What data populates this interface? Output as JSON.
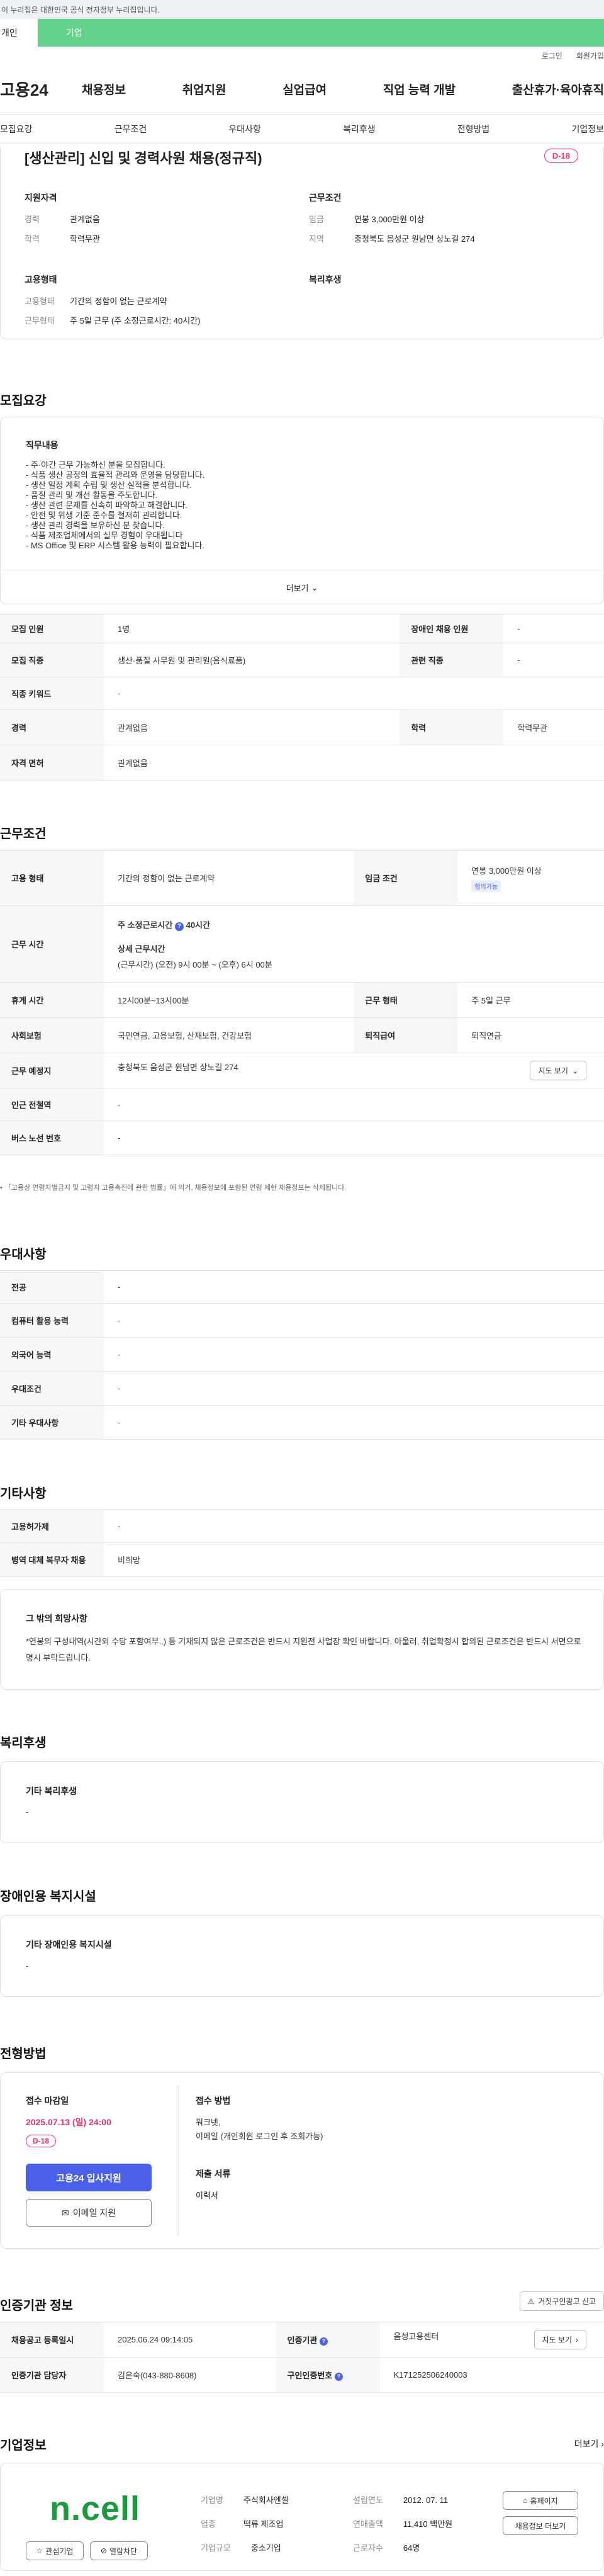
{
  "banner": {
    "text": "이 누리집은 대한민국 공식 전자정부 누리집입니다."
  },
  "topTabs": {
    "a": "개인",
    "b": "기업"
  },
  "util": {
    "login": "로그인",
    "join": "회원가입"
  },
  "gnb": {
    "logo": "고용24",
    "items": [
      "채용정보",
      "취업지원",
      "실업급여",
      "직업 능력 개발",
      "출산휴가·육아휴직"
    ]
  },
  "subnav": [
    "모집요강",
    "근무조건",
    "우대사항",
    "복리후생",
    "전형방법",
    "기업정보"
  ],
  "headerCard": {
    "title": "[생산관리] 신입 및 경력사원 채용(정규직)",
    "dday": "D-18",
    "qualTitle": "지원자격",
    "qual": [
      {
        "k": "경력",
        "v": "관계없음"
      },
      {
        "k": "학력",
        "v": "학력무관"
      }
    ],
    "condTitle": "근무조건",
    "cond": [
      {
        "k": "임금",
        "v": "연봉 3,000만원 이상"
      },
      {
        "k": "지역",
        "v": "충청북도 음성군 원남면 상노길 274"
      }
    ],
    "empTitle": "고용형태",
    "emp": [
      {
        "k": "고용형태",
        "v": "기간의 정함이 없는 근로계약"
      },
      {
        "k": "근무형태",
        "v": "주 5일 근무 (주 소정근로시간: 40시간)"
      }
    ],
    "welfareTitle": "복리후생"
  },
  "recruit": {
    "title": "모집요강",
    "dutyTitle": "직무내용",
    "duties": [
      "- 주·야간 근무 가능하신 분을 모집합니다.",
      "- 식품 생산 공정의 효율적 관리와 운영을 담당합니다.",
      "- 생산 일정 계획 수립 및 생산 실적을 분석합니다.",
      "- 품질 관리 및 개선 활동을 주도합니다.",
      "- 생산 관련 문제를 신속히 파악하고 해결합니다.",
      "- 안전 및 위생 기준 준수를 철저히 관리합니다.",
      "- 생산 관리 경력을 보유하신 분 찾습니다.",
      "- 식품 제조업체에서의 실무 경험이 우대됩니다",
      "- MS Office 및 ERP 시스템 활용 능력이 필요합니다."
    ],
    "more": "더보기"
  },
  "recruitTable": {
    "rows": [
      {
        "k1": "모집 인원",
        "v1": "1명",
        "k2": "장애인 채용 인원",
        "v2": "-"
      },
      {
        "k1": "모집 직종",
        "v1": "생산·품질 사무원 및 관리원(음식료품)",
        "k2": "관련 직종",
        "v2": "-"
      },
      {
        "k1": "직종 키워드",
        "v1": "-"
      },
      {
        "k1": "경력",
        "v1": "관계없음",
        "k2": "학력",
        "v2": "학력무관"
      },
      {
        "k1": "자격 면허",
        "v1": "관계없음"
      }
    ]
  },
  "work": {
    "title": "근무조건",
    "empType": {
      "k": "고용 형태",
      "v": "기간의 정함이 없는 근로계약"
    },
    "wage": {
      "k": "임금 조건",
      "v": "연봉 3,000만원 이상",
      "badge": "협의가능"
    },
    "hours": {
      "k": "근무 시간",
      "line1": "주 소정근로시간",
      "hrs": "40시간",
      "line2": "상세 근무시간",
      "line3": "(근무시간) (오전) 9시 00분 ~ (오후) 6시 00분"
    },
    "break": {
      "k": "휴게 시간",
      "v": "12시00분~13시00분",
      "k2": "근무 형태",
      "v2": "주 5일 근무"
    },
    "insurance": {
      "k": "사회보험",
      "v": "국민연금, 고용보험, 산재보험, 건강보험",
      "k2": "퇴직급여",
      "v2": "퇴직연금"
    },
    "place": {
      "k": "근무 예정지",
      "v": "충청북도 음성군 원남면 상노길 274",
      "btn": "지도 보기"
    },
    "subway": {
      "k": "인근 전철역",
      "v": "-"
    },
    "bus": {
      "k": "버스 노선 번호",
      "v": "-"
    },
    "note": "「고용상 연령차별금지 및 고령자 고용촉진에 관한 법률」에 의거, 채용정보에 포함된 연령 제한 채용정보는 삭제됩니다."
  },
  "pref": {
    "title": "우대사항",
    "rows": [
      {
        "k": "전공",
        "v": "-"
      },
      {
        "k": "컴퓨터 활용 능력",
        "v": "-"
      },
      {
        "k": "외국어 능력",
        "v": "-"
      },
      {
        "k": "우대조건",
        "v": "-"
      },
      {
        "k": "기타 우대사항",
        "v": "-"
      }
    ]
  },
  "etc": {
    "title": "기타사항",
    "rows": [
      {
        "k": "고용허가제",
        "v": "-"
      },
      {
        "k": "병역 대체 복무자 채용",
        "v": "비희망"
      }
    ],
    "boxTitle": "그 밖의 희망사항",
    "boxText": "*연봉의 구성내역(시간외 수당 포함여부..) 등 기재되지 않은 근로조건은 반드시 지원전 사업장 확인 바랍니다. 아울러, 취업확정시 합의된 근로조건은 반드시 서면으로 명시 부탁드립니다."
  },
  "welfare": {
    "title": "복리후생",
    "sub": "기타 복리후생",
    "v": "-"
  },
  "disability": {
    "title": "장애인용 복지시설",
    "sub": "기타 장애인용 복지시설",
    "v": "-"
  },
  "process": {
    "title": "전형방법",
    "deadlineK": "접수 마감일",
    "deadline": "2025.07.13 (일) 24:00",
    "dday": "D-18",
    "applyBtn": "고용24 입사지원",
    "emailBtn": "이메일 지원",
    "methodK": "접수 방법",
    "method1": "워크넷,",
    "method2": "이메일 (개인회원 로그인 후 조회가능)",
    "docsK": "제출 서류",
    "docs": "이력서"
  },
  "agency": {
    "title": "인증기관 정보",
    "reportBtn": "거짓구인광고 신고",
    "rows": [
      {
        "k1": "채용공고 등록일시",
        "v1": "2025.06.24 09:14:05",
        "k2": "인증기관",
        "v2": "음성고용센터",
        "btn": "지도 보기"
      },
      {
        "k1": "인증기관 담당자",
        "v1": "김은숙(043-880-8608)",
        "k2": "구인인증번호",
        "v2": "K171252506240003"
      }
    ]
  },
  "company": {
    "title": "기업정보",
    "more": "더보기",
    "logo": "n.cell",
    "fav": "관심기업",
    "block": "열람차단",
    "info": [
      {
        "k": "기업명",
        "v": "주식회사엔셀"
      },
      {
        "k": "업종",
        "v": "떡류 제조업"
      },
      {
        "k": "기업규모",
        "v": "중소기업"
      }
    ],
    "info2": [
      {
        "k": "설립연도",
        "v": "2012. 07. 11"
      },
      {
        "k": "연매출액",
        "v": "11,410 백만원"
      },
      {
        "k": "근로자수",
        "v": "64명"
      }
    ],
    "homeBtn": "홈페이지",
    "jobsBtn": "채용정보 더보기"
  },
  "colors": {
    "green": "#63d28c",
    "blue": "#4a60e8",
    "pink": "#e8336a"
  }
}
